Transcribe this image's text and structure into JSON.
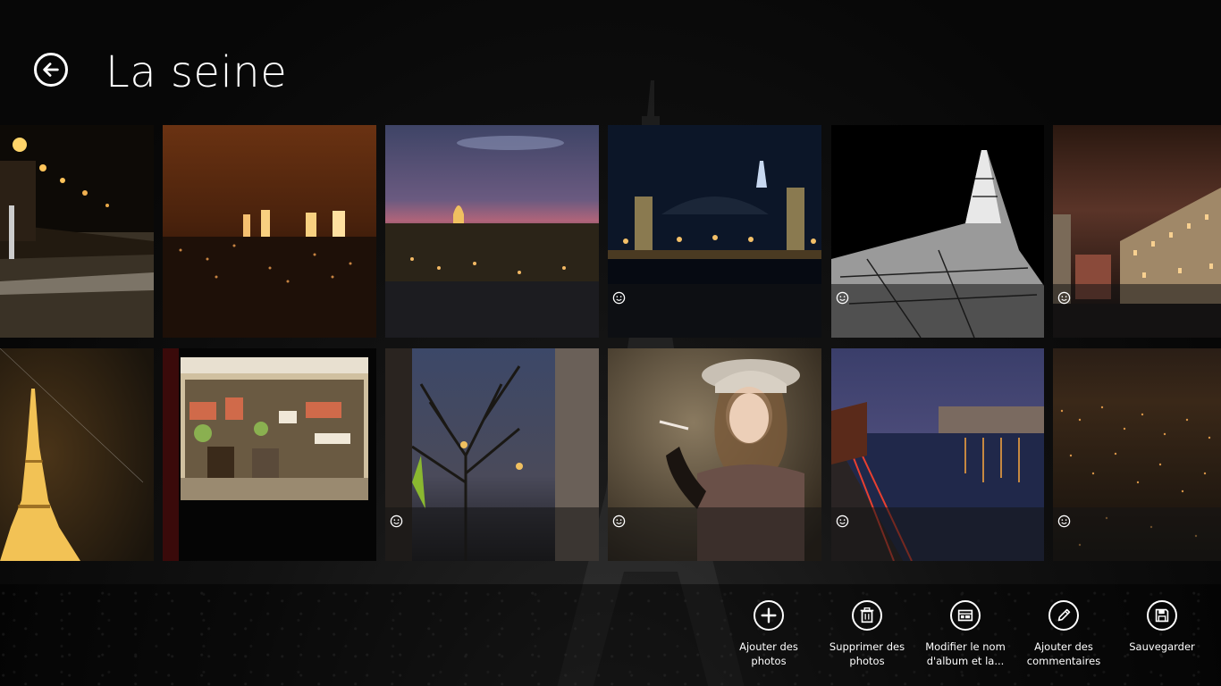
{
  "header": {
    "title": "La seine"
  },
  "photos": [
    {
      "name": "street-night",
      "has_comment": false
    },
    {
      "name": "skyline-orange",
      "has_comment": false
    },
    {
      "name": "invalides-dusk",
      "has_comment": false
    },
    {
      "name": "grand-palais-bridge",
      "has_comment": true
    },
    {
      "name": "eiffel-bw",
      "has_comment": true
    },
    {
      "name": "hotel-de-ville",
      "has_comment": true
    },
    {
      "name": "eiffel-gold",
      "has_comment": false
    },
    {
      "name": "market-stall",
      "has_comment": false
    },
    {
      "name": "tree-street",
      "has_comment": true
    },
    {
      "name": "woman-hat",
      "has_comment": true
    },
    {
      "name": "seine-river",
      "has_comment": true
    },
    {
      "name": "city-lights",
      "has_comment": true
    }
  ],
  "appbar": {
    "add_photos": "Ajouter des\nphotos",
    "delete_photos": "Supprimer des\nphotos",
    "rename_album": "Modifier le nom\nd'album et la...",
    "add_comments": "Ajouter des\ncommentaires",
    "save": "Sauvegarder"
  },
  "colors": {
    "background": "#0b0b0b",
    "foreground": "#ffffff",
    "tile_overlay": "rgba(20,20,20,0.55)"
  },
  "icons": {
    "back": "back-arrow-icon",
    "add": "plus-icon",
    "delete": "trash-icon",
    "rename": "rename-card-icon",
    "comment": "pencil-icon",
    "save": "floppy-disk-icon",
    "comment_marker": "smiley-icon"
  }
}
